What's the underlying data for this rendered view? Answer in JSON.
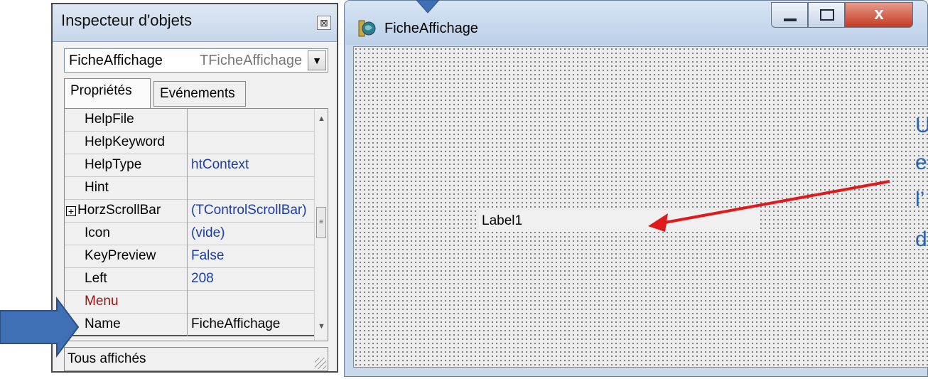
{
  "inspector": {
    "title": "Inspecteur d'objets",
    "close_icon": "⊠",
    "selected_object": {
      "name": "FicheAffichage",
      "type": "TFicheAffichage"
    },
    "tabs": [
      {
        "label": "Propriétés",
        "active": true
      },
      {
        "label": "Evénements",
        "active": false
      }
    ],
    "properties": [
      {
        "name": "HelpFile",
        "value": ""
      },
      {
        "name": "HelpKeyword",
        "value": ""
      },
      {
        "name": "HelpType",
        "value": "htContext"
      },
      {
        "name": "Hint",
        "value": ""
      },
      {
        "name": "HorzScrollBar",
        "value": "(TControlScrollBar)",
        "expandable": true
      },
      {
        "name": "Icon",
        "value": "(vide)"
      },
      {
        "name": "KeyPreview",
        "value": "False"
      },
      {
        "name": "Left",
        "value": "208"
      },
      {
        "name": "Menu",
        "value": ""
      },
      {
        "name": "Name",
        "value": "FicheAffichage",
        "selected": true
      }
    ],
    "status": "Tous affichés"
  },
  "form": {
    "title": "FicheAffichage",
    "label_component": "Label1",
    "close_glyph": "x"
  },
  "annotation_text": [
    "U",
    "e",
    "l’",
    "d"
  ],
  "colors": {
    "pointer_arrow": "#e01a1a",
    "callout_arrow": "#3f6fb5",
    "annotation_text": "#2a64b7"
  }
}
